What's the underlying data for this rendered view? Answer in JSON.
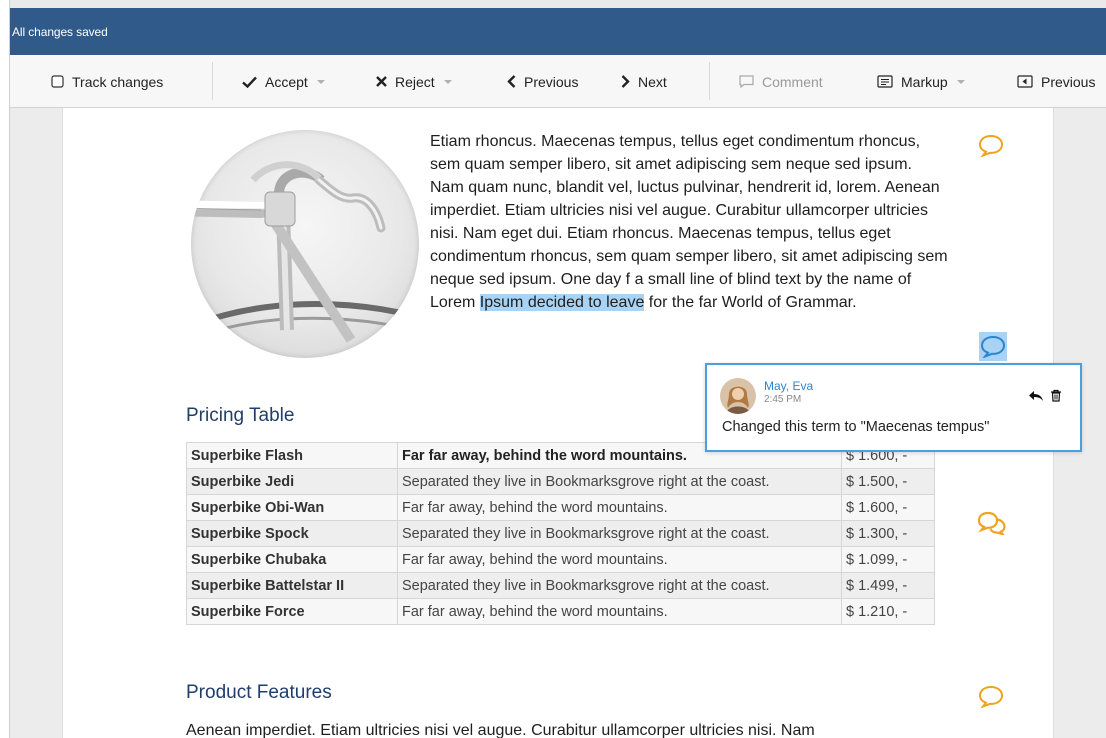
{
  "status_bar": {
    "text": "All changes saved",
    "color": "#2f5a8a"
  },
  "toolbar": {
    "track_changes": {
      "label": "Track changes",
      "icon": "checkbox-icon"
    },
    "accept": {
      "label": "Accept",
      "icon": "check-icon"
    },
    "reject": {
      "label": "Reject",
      "icon": "x-icon"
    },
    "previous": {
      "label": "Previous",
      "icon": "chevron-left-icon"
    },
    "next": {
      "label": "Next",
      "icon": "chevron-right-icon"
    },
    "comment": {
      "label": "Comment",
      "icon": "comment-icon",
      "disabled": true
    },
    "markup": {
      "label": "Markup",
      "icon": "markup-icon"
    },
    "previous2": {
      "label": "Previous",
      "icon": "preview-icon"
    }
  },
  "document": {
    "paragraph": {
      "before": "Etiam rhoncus. Maecenas tempus, tellus eget condimentum rhoncus, sem quam semper libero, sit amet adipiscing sem neque sed ipsum. Nam quam nunc, blandit vel, luctus pulvinar, hendrerit id, lorem. Aenean imperdiet. Etiam ultricies nisi vel augue. Curabitur ullamcorper ultricies nisi. Nam eget dui. Etiam rhoncus. Maecenas tempus, tellus eget condimentum rhoncus, sem quam semper libero, sit amet adipiscing sem neque sed ipsum. One day f a small line of blind text by the name of Lorem ",
      "highlighted": "Ipsum decided to leave",
      "after": " for the far World of Grammar."
    },
    "pricing_title": "Pricing Table",
    "pricing_rows": [
      {
        "name": "Superbike Flash",
        "desc": "Far far away, behind the word mountains.",
        "price": "$ 1.600, -"
      },
      {
        "name": "Superbike Jedi",
        "desc": "Separated they live in Bookmarksgrove right at the coast.",
        "price": "$ 1.500, -"
      },
      {
        "name": "Superbike Obi-Wan",
        "desc": "Far far away, behind the word mountains.",
        "price": "$ 1.600, -"
      },
      {
        "name": "Superbike Spock",
        "desc": "Separated they live in Bookmarksgrove right at the coast.",
        "price": "$ 1.300, -"
      },
      {
        "name": "Superbike Chubaka",
        "desc": "Far far away, behind the word mountains.",
        "price": "$ 1.099, -"
      },
      {
        "name": "Superbike Battelstar II",
        "desc": "Separated they live in Bookmarksgrove right at the coast.",
        "price": "$ 1.499, -"
      },
      {
        "name": "Superbike Force",
        "desc": "Far far away, behind the word mountains.",
        "price": "$ 1.210, -"
      }
    ],
    "features_title": "Product Features",
    "features_text": "Aenean imperdiet. Etiam ultricies nisi vel augue. Curabitur ullamcorper ultricies nisi. Nam"
  },
  "comment_popup": {
    "author": "May, Eva",
    "time": "2:45 PM",
    "text": "Changed this term to \"Maecenas tempus\"",
    "icons": [
      "reply-icon",
      "trash-icon"
    ]
  },
  "colors": {
    "accent_orange": "#f0a31f",
    "accent_blue": "#4a9fe0",
    "highlight": "#a9d3f5",
    "heading": "#1f3f6a"
  }
}
